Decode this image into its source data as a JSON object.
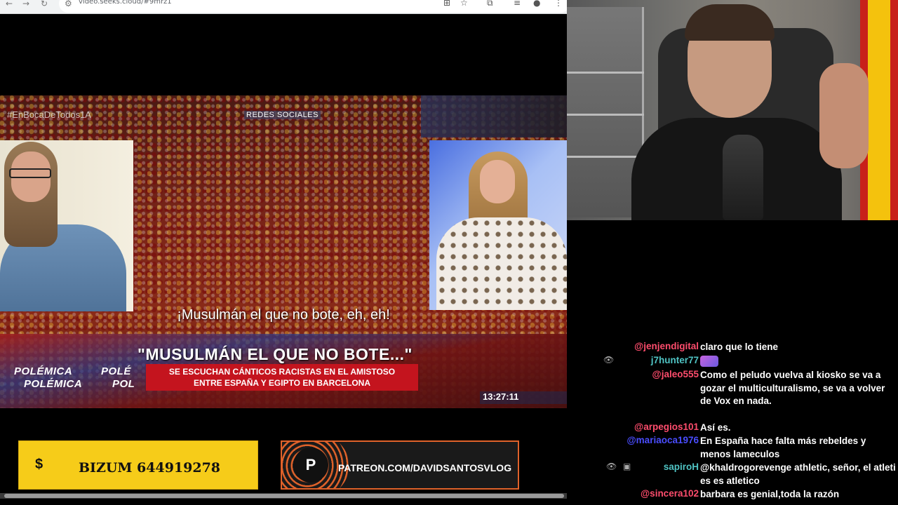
{
  "browser": {
    "url": "video.seeks.cloud/#9mrz1",
    "icons": {
      "back": "back-arrow-icon",
      "forward": "forward-arrow-icon",
      "reload": "reload-icon",
      "site": "site-settings-icon"
    }
  },
  "tv": {
    "hashtag": "#EnBocaDeTodos1A",
    "section_tag": "REDES SOCIALES",
    "subtitle": "¡Musulmán el que no bote, eh, eh!",
    "headline": "\"MUSULMÁN EL QUE NO BOTE...\"",
    "band_line1": "SE ESCUCHAN CÁNTICOS RACISTAS EN EL AMISTOSO",
    "band_line2": "ENTRE ESPAÑA Y EGIPTO EN BARCELONA",
    "polemica_1": "POLÉMICA",
    "polemica_2": "POLÉ",
    "polemica_3": "POLÉMICA",
    "polemica_4": "POL",
    "clock": "13:27:11"
  },
  "banners": {
    "bizum_symbol": "$",
    "bizum_text": "BIZUM 644919278",
    "patreon_logo": "P",
    "patreon_text": "PATREON.COM/DAVIDSANTOSVLOG"
  },
  "chat": {
    "messages": [
      {
        "user": "@jenjendigital",
        "color": "#ff4d6d",
        "text": "claro que lo tiene"
      },
      {
        "user": "j7hunter77",
        "color": "#4fc3c3",
        "text": "",
        "emote": true
      },
      {
        "user": "@jaleo555",
        "color": "#ff4d6d",
        "text": "Como el peludo vuelva al kiosko se va a gozar el multiculturalismo, se va a volver de Vox en nada."
      },
      {
        "user": "@arpegios101",
        "color": "#ff4d6d",
        "text": "Así es."
      },
      {
        "user": "@mariaoca1976",
        "color": "#4a4dff",
        "text": "En España hace falta más rebeldes y menos lameculos"
      },
      {
        "user": "sapiroH",
        "color": "#4fc3c3",
        "text": "@khaldrogorevenge athletic, señor, el atleti es es atletico"
      },
      {
        "user": "@sincera102",
        "color": "#ff4d6d",
        "text": "barbara es genial,toda la razón"
      }
    ]
  }
}
